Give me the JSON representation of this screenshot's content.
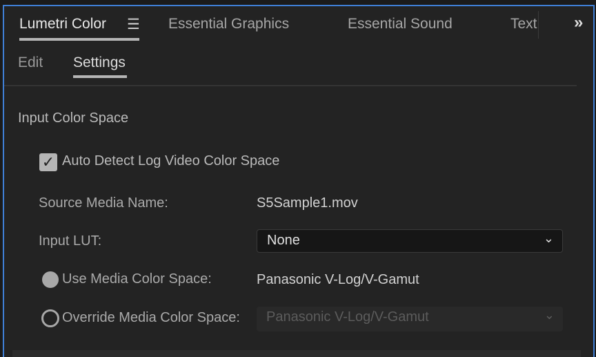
{
  "tabs": [
    {
      "label": "Lumetri Color"
    },
    {
      "label": "Essential Graphics"
    },
    {
      "label": "Essential Sound"
    },
    {
      "label": "Text"
    }
  ],
  "subtabs": [
    {
      "label": "Edit"
    },
    {
      "label": "Settings"
    }
  ],
  "section_title": "Input Color Space",
  "auto_detect": {
    "label": "Auto Detect Log Video Color Space",
    "checked": true
  },
  "source_media": {
    "label": "Source Media Name:",
    "value": "S5Sample1.mov"
  },
  "input_lut": {
    "label": "Input LUT:",
    "value": "None"
  },
  "use_media": {
    "label": "Use Media Color Space:",
    "value": "Panasonic V-Log/V-Gamut",
    "selected": true
  },
  "override_media": {
    "label": "Override Media Color Space:",
    "value": "Panasonic V-Log/V-Gamut",
    "selected": false
  },
  "colors": {
    "accent": "#3f7fd6",
    "background": "#232323"
  }
}
